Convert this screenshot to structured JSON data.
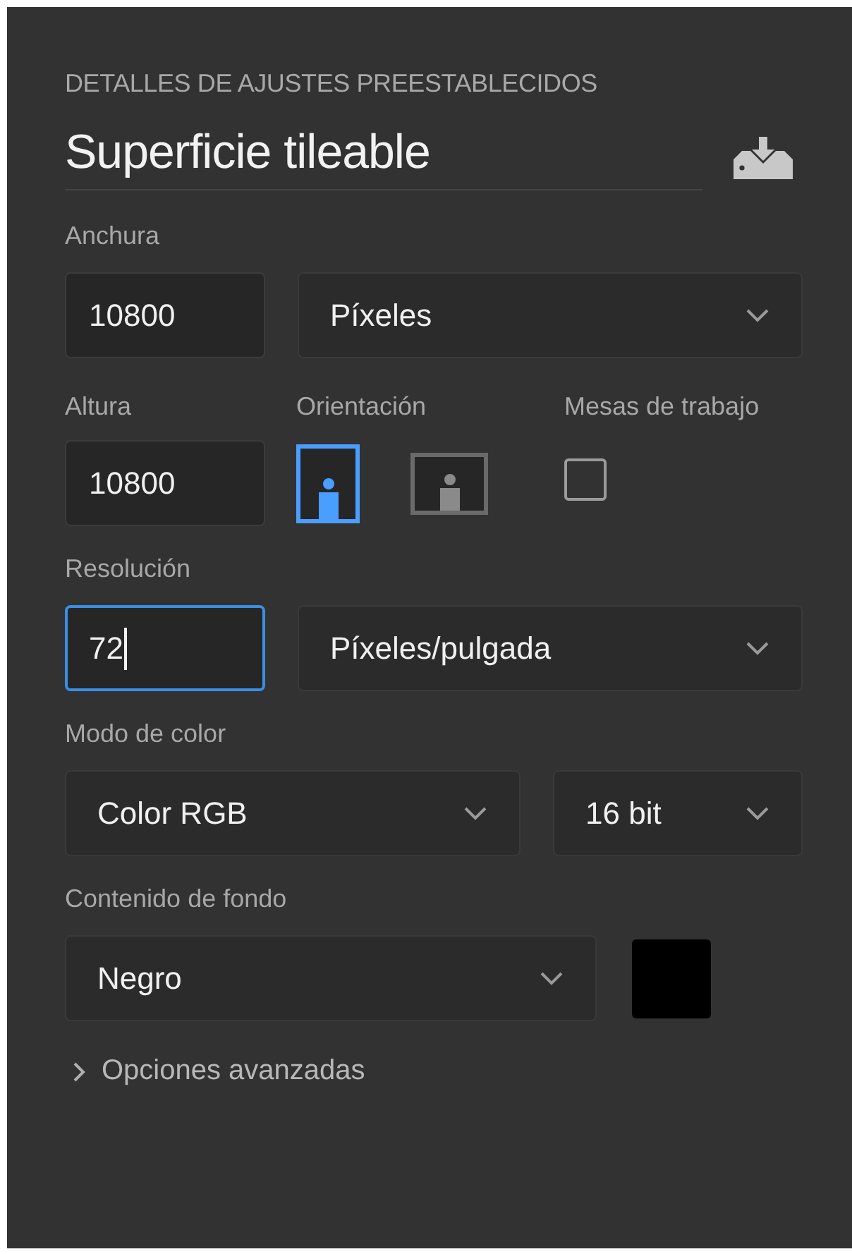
{
  "section_title": "DETALLES DE AJUSTES PREESTABLECIDOS",
  "preset_name": "Superficie tileable",
  "width": {
    "label": "Anchura",
    "value": "10800",
    "unit": "Píxeles"
  },
  "height": {
    "label": "Altura",
    "value": "10800"
  },
  "orientation": {
    "label": "Orientación",
    "options": [
      {
        "kind": "portrait",
        "selected": true
      },
      {
        "kind": "landscape",
        "selected": false
      }
    ]
  },
  "artboards": {
    "label": "Mesas de trabajo",
    "checked": false
  },
  "resolution": {
    "label": "Resolución",
    "value": "72",
    "focused": true,
    "unit": "Píxeles/pulgada"
  },
  "color_mode": {
    "label": "Modo de color",
    "mode": "Color RGB",
    "depth": "16 bit"
  },
  "background": {
    "label": "Contenido de fondo",
    "value": "Negro",
    "color": "#000000"
  },
  "advanced": {
    "label": "Opciones avanzadas",
    "expanded": false
  }
}
